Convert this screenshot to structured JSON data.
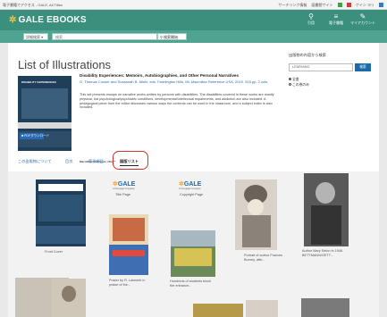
{
  "browser": {
    "left_text": "電子書籍でアクセス - GALE, All Titles",
    "right_items": [
      "サーチリンク情報",
      "図書館サイト",
      "ゲイン ヨリ"
    ]
  },
  "header": {
    "brand": "GALE EBOOKS",
    "icons": [
      {
        "name": "bookmark-icon",
        "glyph": "⚲",
        "label": "引用"
      },
      {
        "name": "list-icon",
        "glyph": "≡",
        "label": "電子書籍"
      },
      {
        "name": "settings-icon",
        "glyph": "✎",
        "label": "マイアカウント"
      }
    ]
  },
  "search": {
    "scope": "詳細検索 ▾",
    "placeholder": "検索",
    "button_label": "⚲ 検索開始"
  },
  "page": {
    "title": "List of Illustrations"
  },
  "book": {
    "cover_title": "DISABILITY EXPERIENCES",
    "title": "Disability Experiences: Memoirs, Autobiographies, and Other Personal Narratives",
    "meta": "G. Thomas Couser and Susannah B. Mintz, eds. Farmington Hills, MI: Macmillan Reference USA, 2019. 915 pp. 2 vols.",
    "description": "This set presents essays on narrative works written by persons with disabilities. The disabilities covered in these works are mostly physical, but psychological/psychiatric conditions, developmental/intellectual impairments, and addiction are also included. A pedagogical piece from the editor discusses various ways the contents can be used in the classroom, and a subject index is also included.",
    "pdf_button": "■ PDFダウンロード",
    "publisher_logo": "Macmillan Reference USA™"
  },
  "sidebar": {
    "heading": "出版物の内容から検索",
    "input_placeholder": "LEARNING",
    "go_label": "検索",
    "options": [
      "全書",
      "この巻のみ"
    ]
  },
  "tabs": [
    "この出版物について",
    "目次",
    "索引項目",
    "図版リスト"
  ],
  "active_tab": 3,
  "gallery": [
    {
      "caption": "Front Cover"
    },
    {
      "caption": "Title Page",
      "logo": "GALE"
    },
    {
      "caption": "Copyright Page",
      "logo": "GALE"
    },
    {
      "caption": "Poster by R. Lakewrh in praise of the..."
    },
    {
      "caption": "Hundreds of students block the entrance..."
    },
    {
      "caption": "Portrait of author Frances Burney, afte..."
    },
    {
      "caption": "Author Mary Seton in 1946. BETTMANN/GETT..."
    }
  ]
}
